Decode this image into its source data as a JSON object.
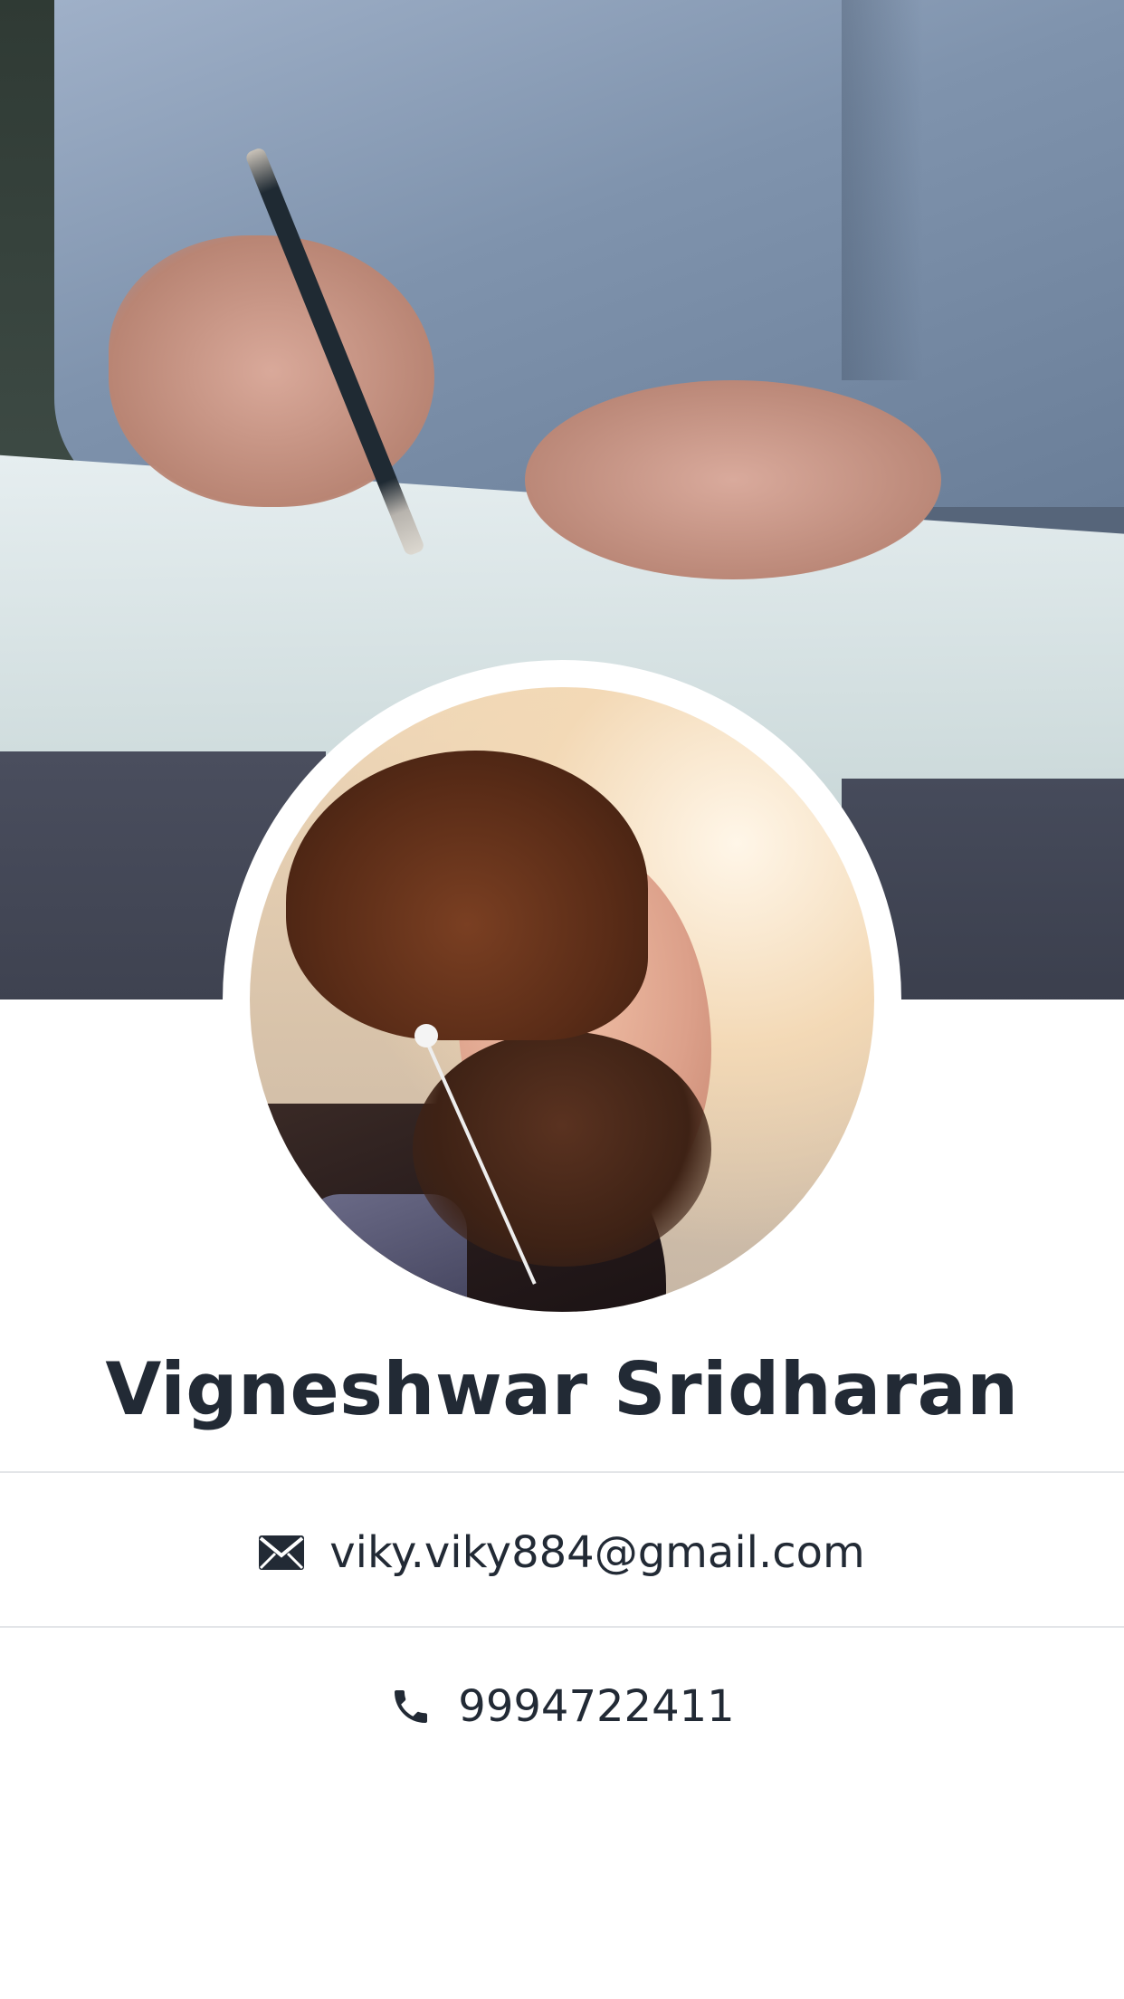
{
  "profile": {
    "name": "Vigneshwar Sridharan",
    "email": "viky.viky884@gmail.com",
    "phone": "9994722411"
  },
  "icons": {
    "email": "envelope-icon",
    "phone": "phone-icon"
  },
  "colors": {
    "text": "#222a35",
    "divider": "#e3e5e8",
    "background": "#ffffff"
  }
}
